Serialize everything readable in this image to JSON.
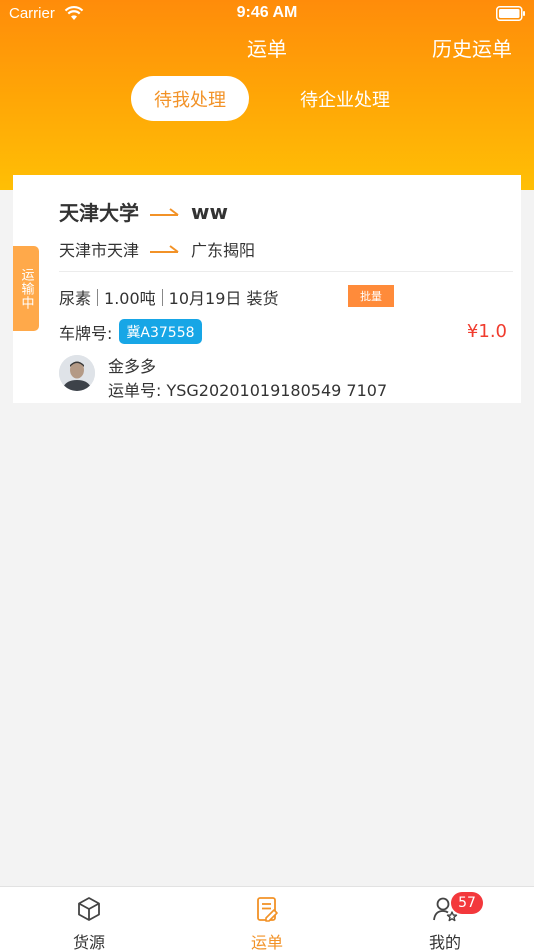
{
  "status_bar": {
    "carrier": "Carrier",
    "time": "9:46 AM"
  },
  "nav": {
    "title": "运单",
    "history": "历史运单"
  },
  "segments": {
    "mine": "待我处理",
    "company": "待企业处理"
  },
  "order": {
    "status": "运输中",
    "from_name": "天津大学",
    "to_name": "ww",
    "from_city": "天津市天津",
    "to_city": "广东揭阳",
    "cargo": "尿素",
    "weight": "1.00吨",
    "date_action": "10月19日 装货",
    "batch": "批量",
    "plate_label": "车牌号:",
    "plate": "冀A37558",
    "price": "¥1.0",
    "driver": "金多多",
    "waybill": "运单号: YSG20201019180549 7107"
  },
  "tabs": [
    {
      "label": "货源",
      "icon": "cube-icon"
    },
    {
      "label": "运单",
      "icon": "document-icon"
    },
    {
      "label": "我的",
      "icon": "user-icon",
      "badge": "57"
    }
  ],
  "colors": {
    "accent": "#f29227",
    "header_top": "#ff8c0a",
    "header_bottom": "#ffbf05",
    "price": "#f03c2e",
    "plate": "#17a6e6"
  }
}
